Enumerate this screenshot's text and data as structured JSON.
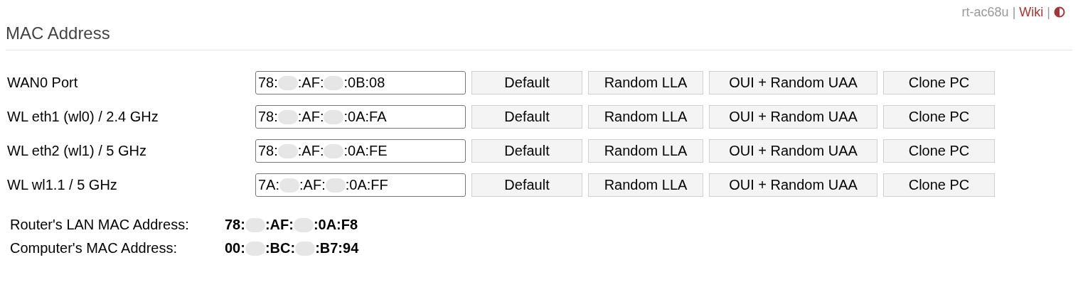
{
  "header": {
    "device": "rt-ac68u",
    "separator_1": "|",
    "link": "Wiki",
    "separator_2": "|"
  },
  "title": "MAC Address",
  "rows": [
    {
      "label": "WAN0 Port",
      "value_parts": [
        "78:",
        ":AF:",
        ":0B:08"
      ],
      "buttons": [
        "Default",
        "Random LLA",
        "OUI + Random UAA",
        "Clone PC"
      ]
    },
    {
      "label": "WL eth1 (wl0) / 2.4 GHz",
      "value_parts": [
        "78:",
        ":AF:",
        ":0A:FA"
      ],
      "buttons": [
        "Default",
        "Random LLA",
        "OUI + Random UAA",
        "Clone PC"
      ]
    },
    {
      "label": "WL eth2 (wl1) / 5 GHz",
      "value_parts": [
        "78:",
        ":AF:",
        ":0A:FE"
      ],
      "buttons": [
        "Default",
        "Random LLA",
        "OUI + Random UAA",
        "Clone PC"
      ]
    },
    {
      "label": "WL wl1.1 / 5 GHz",
      "value_parts": [
        "7A:",
        ":AF:",
        ":0A:FF"
      ],
      "buttons": [
        "Default",
        "Random LLA",
        "OUI + Random UAA",
        "Clone PC"
      ]
    }
  ],
  "info": [
    {
      "label": "Router's LAN MAC Address:",
      "value_parts": [
        "78:",
        ":AF:",
        ":0A:F8"
      ]
    },
    {
      "label": "Computer's MAC Address:",
      "value_parts": [
        "00:",
        ":BC:",
        ":B7:94"
      ]
    }
  ]
}
